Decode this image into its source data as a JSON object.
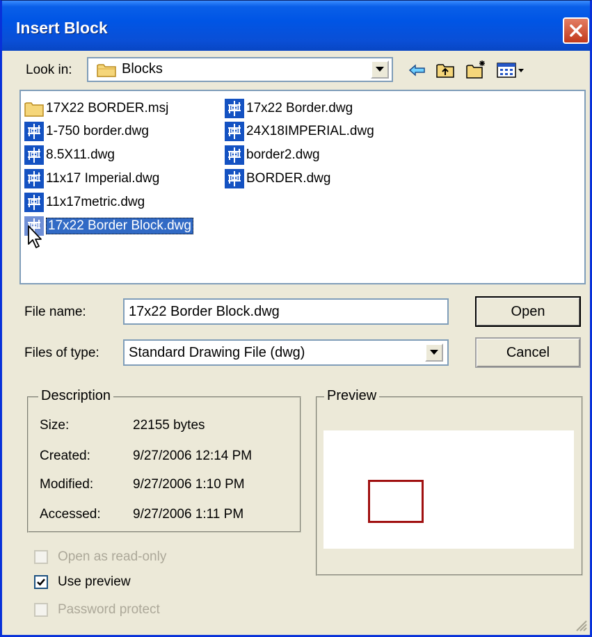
{
  "window": {
    "title": "Insert Block"
  },
  "look_in": {
    "label": "Look in:",
    "value": "Blocks"
  },
  "toolbar": {
    "back_icon": "back-arrow-icon",
    "up_icon": "up-folder-icon",
    "new_folder_icon": "new-folder-icon",
    "views_icon": "views-menu-icon"
  },
  "files": [
    {
      "name": "17X22 BORDER.msj",
      "type": "folder"
    },
    {
      "name": "1-750 border.dwg",
      "type": "dwg"
    },
    {
      "name": "8.5X11.dwg",
      "type": "dwg"
    },
    {
      "name": "11x17 Imperial.dwg",
      "type": "dwg"
    },
    {
      "name": "11x17metric.dwg",
      "type": "dwg"
    },
    {
      "name": "17x22 Border Block.dwg",
      "type": "dwg",
      "selected": true
    },
    {
      "name": "17x22 Border.dwg",
      "type": "dwg"
    },
    {
      "name": "24X18IMPERIAL.dwg",
      "type": "dwg"
    },
    {
      "name": "border2.dwg",
      "type": "dwg"
    },
    {
      "name": "BORDER.dwg",
      "type": "dwg"
    }
  ],
  "file_name": {
    "label": "File name:",
    "value": "17x22 Border Block.dwg"
  },
  "files_of_type": {
    "label": "Files of type:",
    "value": "Standard Drawing File (dwg)"
  },
  "buttons": {
    "open": "Open",
    "cancel": "Cancel"
  },
  "description": {
    "title": "Description",
    "rows": [
      {
        "label": "Size:",
        "value": "22155 bytes"
      },
      {
        "label": "Created:",
        "value": "9/27/2006 12:14 PM"
      },
      {
        "label": "Modified:",
        "value": "9/27/2006 1:10 PM"
      },
      {
        "label": "Accessed:",
        "value": "9/27/2006 1:11 PM"
      }
    ]
  },
  "preview": {
    "title": "Preview"
  },
  "options": {
    "open_read_only": {
      "label": "Open as read-only",
      "checked": false,
      "enabled": false
    },
    "use_preview": {
      "label": "Use preview",
      "checked": true,
      "enabled": true
    },
    "password_protect": {
      "label": "Password protect",
      "checked": false,
      "enabled": false
    }
  },
  "colors": {
    "title_bar": "#0055e5",
    "selection": "#316ac5",
    "preview_border": "#a01010"
  }
}
